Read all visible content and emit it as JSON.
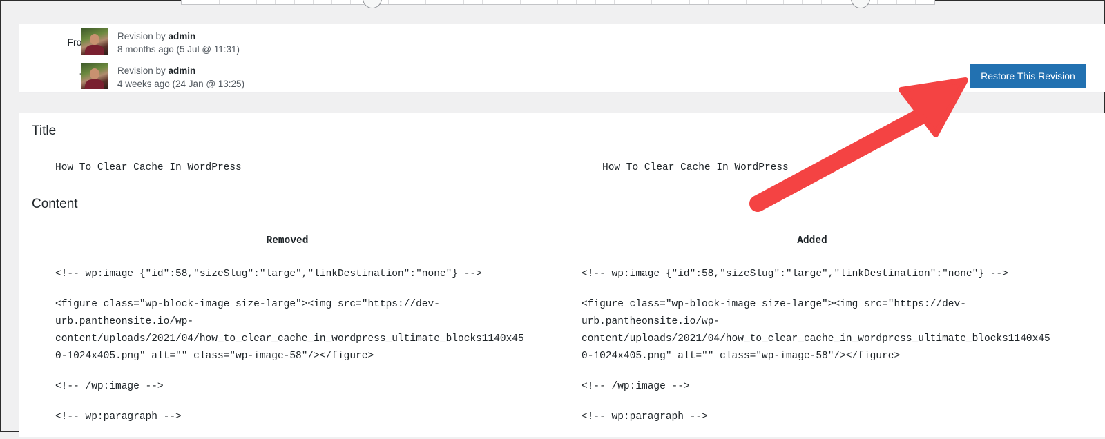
{
  "meta": {
    "from_label": "From:",
    "to_label": "To:",
    "from": {
      "revision_by": "Revision by",
      "author": "admin",
      "time": "8 months ago (5 Jul @ 11:31)"
    },
    "to": {
      "revision_by": "Revision by",
      "author": "admin",
      "time": "4 weeks ago (24 Jan @ 13:25)"
    },
    "restore_label": "Restore This Revision"
  },
  "diff": {
    "title_heading": "Title",
    "title_left": "How To Clear Cache In WordPress",
    "title_right": "How To Clear Cache In WordPress",
    "content_heading": "Content",
    "removed_label": "Removed",
    "added_label": "Added",
    "left_lines": [
      "<!-- wp:image {\"id\":58,\"sizeSlug\":\"large\",\"linkDestination\":\"none\"} -->",
      "<figure class=\"wp-block-image size-large\"><img src=\"https://dev-\nurb.pantheonsite.io/wp-\ncontent/uploads/2021/04/how_to_clear_cache_in_wordpress_ultimate_blocks1140x45\n0-1024x405.png\" alt=\"\" class=\"wp-image-58\"/></figure>",
      "<!-- /wp:image -->",
      "<!-- wp:paragraph -->"
    ],
    "right_lines": [
      "<!-- wp:image {\"id\":58,\"sizeSlug\":\"large\",\"linkDestination\":\"none\"} -->",
      "<figure class=\"wp-block-image size-large\"><img src=\"https://dev-\nurb.pantheonsite.io/wp-\ncontent/uploads/2021/04/how_to_clear_cache_in_wordpress_ultimate_blocks1140x45\n0-1024x405.png\" alt=\"\" class=\"wp-image-58\"/></figure>",
      "<!-- /wp:image -->",
      "<!-- wp:paragraph -->"
    ]
  },
  "colors": {
    "primary_button": "#2271b1",
    "annotation_arrow": "#f44343"
  }
}
